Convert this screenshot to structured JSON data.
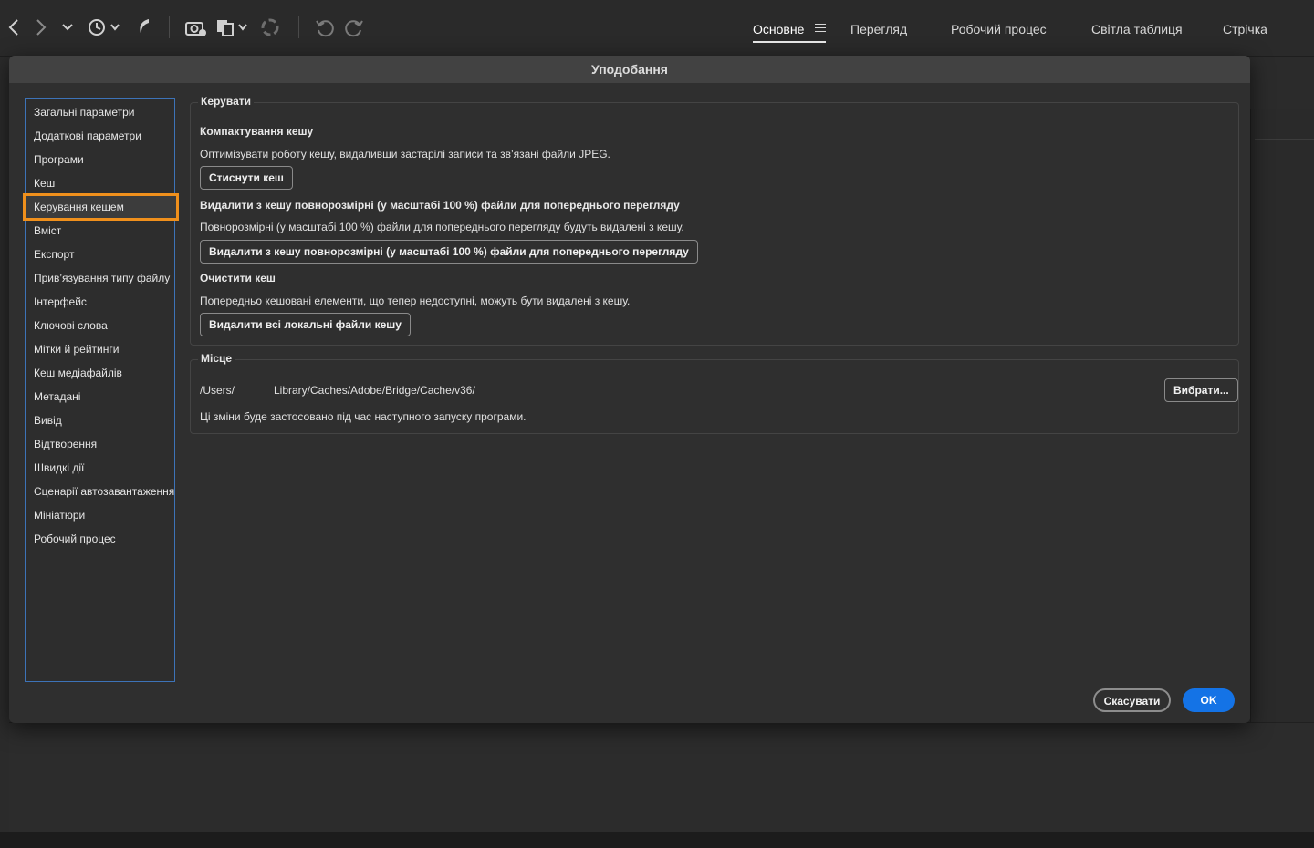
{
  "toolbar": {
    "icons": [
      "back-icon",
      "forward-icon",
      "chevron-down-icon",
      "recent-history-icon",
      "boomerang-icon",
      "camera-import-icon",
      "copy-icon",
      "refine-icon",
      "rotate-left-icon",
      "rotate-right-icon"
    ]
  },
  "workspaces": {
    "tabs": [
      "Основне",
      "Перегляд",
      "Робочий процес",
      "Світла таблиця",
      "Стрічка"
    ],
    "active": "Основне"
  },
  "dialog": {
    "title": "Уподобання",
    "nav": [
      "Загальні параметри",
      "Додаткові параметри",
      "Програми",
      "Кеш",
      "Керування кешем",
      "Вміст",
      "Експорт",
      "Прив’язування типу файлу",
      "Інтерфейс",
      "Ключові слова",
      "Мітки й рейтинги",
      "Кеш медіафайлів",
      "Метадані",
      "Вивід",
      "Відтворення",
      "Швидкі дії",
      "Сценарії автозавантаження",
      "Мініатюри",
      "Робочий процес"
    ],
    "selected_nav": "Керування кешем",
    "manage": {
      "legend": "Керувати",
      "compact_title": "Компактування кешу",
      "compact_desc": "Оптимізувати роботу кешу, видаливши застарілі записи та зв’язані файли JPEG.",
      "compact_button": "Стиснути кеш",
      "purge_full_title": "Видалити з кешу повнорозмірні (у масштабі 100 %) файли для попереднього перегляду",
      "purge_full_desc": "Повнорозмірні (у масштабі 100 %) файли для попереднього перегляду будуть видалені з кешу.",
      "purge_full_button": "Видалити з кешу повнорозмірні (у масштабі 100 %) файли для попереднього перегляду",
      "clear_title": "Очистити кеш",
      "clear_desc": "Попередньо кешовані елементи, що тепер недоступні, можуть бути видалені з кешу.",
      "clear_button": "Видалити всі локальні файли кешу"
    },
    "location": {
      "legend": "Місце",
      "path_prefix": "/Users/",
      "path_suffix": "Library/Caches/Adobe/Bridge/Cache/v36/",
      "choose_button": "Вибрати...",
      "note": "Ці зміни буде застосовано під час наступного запуску програми."
    },
    "cancel_button": "Скасувати",
    "ok_button": "OK"
  }
}
